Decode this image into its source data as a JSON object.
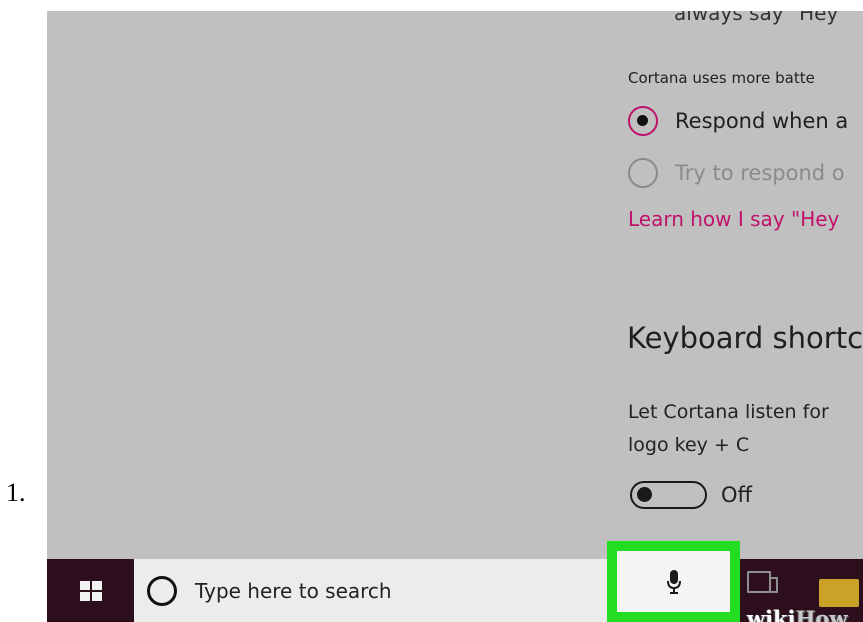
{
  "step": {
    "number": "1."
  },
  "settings": {
    "clipped_top_text": "always say \"Hey",
    "battery_note": "Cortana uses more batte",
    "radio_options": [
      {
        "label": "Respond when a",
        "selected": true
      },
      {
        "label": "Try to respond o",
        "selected": false
      }
    ],
    "learn_link": "Learn how I say \"Hey",
    "keyboard_heading": "Keyboard shortc",
    "shortcut_description_line1": "Let Cortana listen for",
    "shortcut_description_line2": "logo key + C",
    "toggle": {
      "state_label": "Off",
      "on": false
    }
  },
  "taskbar": {
    "search_placeholder": "Type here to search",
    "icons": [
      "windows-logo-icon",
      "cortana-circle-icon",
      "microphone-icon",
      "task-view-icon",
      "file-explorer-folder-icon"
    ]
  },
  "highlight_color": "#22dd22",
  "accent_color": "#c0126b",
  "taskbar_color": "#2c0e1c",
  "watermark": {
    "prefix": "wiki",
    "suffix": "How"
  }
}
